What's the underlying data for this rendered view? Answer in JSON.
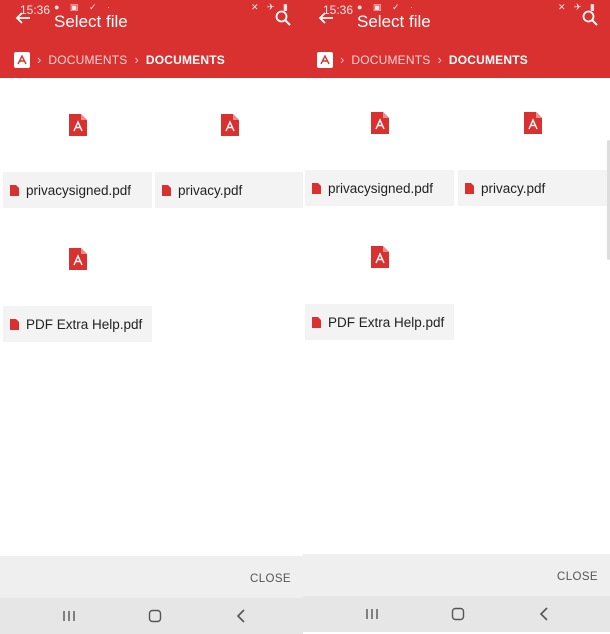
{
  "screens": [
    {
      "status_time": "15:36",
      "title": "Select file",
      "breadcrumbs": [
        "DOCUMENTS",
        "DOCUMENTS"
      ],
      "files": [
        "privacysigned.pdf",
        "privacy.pdf",
        "PDF Extra Help.pdf"
      ],
      "close_label": "CLOSE"
    },
    {
      "status_time": "15:36",
      "title": "Select file",
      "breadcrumbs": [
        "DOCUMENTS",
        "DOCUMENTS"
      ],
      "files": [
        "privacysigned.pdf",
        "privacy.pdf",
        "PDF Extra Help.pdf"
      ],
      "close_label": "CLOSE"
    }
  ],
  "icons": {
    "back": "arrow-left-icon",
    "search": "search-icon",
    "breadcrumb_home": "pdf-app-icon",
    "file": "pdf-file-icon",
    "nav_recents": "recents-icon",
    "nav_home": "home-icon",
    "nav_back": "back-chevron-icon"
  },
  "colors": {
    "appbar": "#d9312f",
    "pdf_red": "#d9312f",
    "name_bar": "#f3f3f3"
  }
}
